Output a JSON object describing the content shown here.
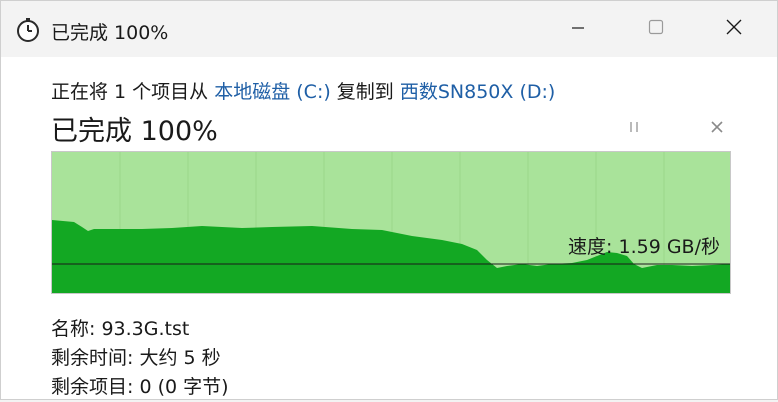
{
  "window": {
    "title": "已完成 100%",
    "icons": {
      "app": "stopwatch-icon",
      "minimize": "minimize-icon",
      "maximize": "maximize-icon",
      "close": "close-icon"
    }
  },
  "status": {
    "prefix": "正在将 1 个项目从 ",
    "source": "本地磁盘 (C:)",
    "middle": " 复制到 ",
    "destination": "西数SN850X (D:)"
  },
  "progress": {
    "title": "已完成 100%",
    "percent": 100,
    "pause_icon": "pause-icon",
    "cancel_icon": "cancel-icon"
  },
  "speed": {
    "label": "速度: 1.59 GB/秒"
  },
  "details": {
    "name_label": "名称: ",
    "name_value": "93.3G.tst",
    "time_label": "剩余时间: ",
    "time_value": "大约 5 秒",
    "items_label": "剩余项目: ",
    "items_value": "0 (0 字节)"
  },
  "colors": {
    "fill_green": "#13a823",
    "area_green": "#a9e39a",
    "link_blue": "#1f5fa6"
  }
}
